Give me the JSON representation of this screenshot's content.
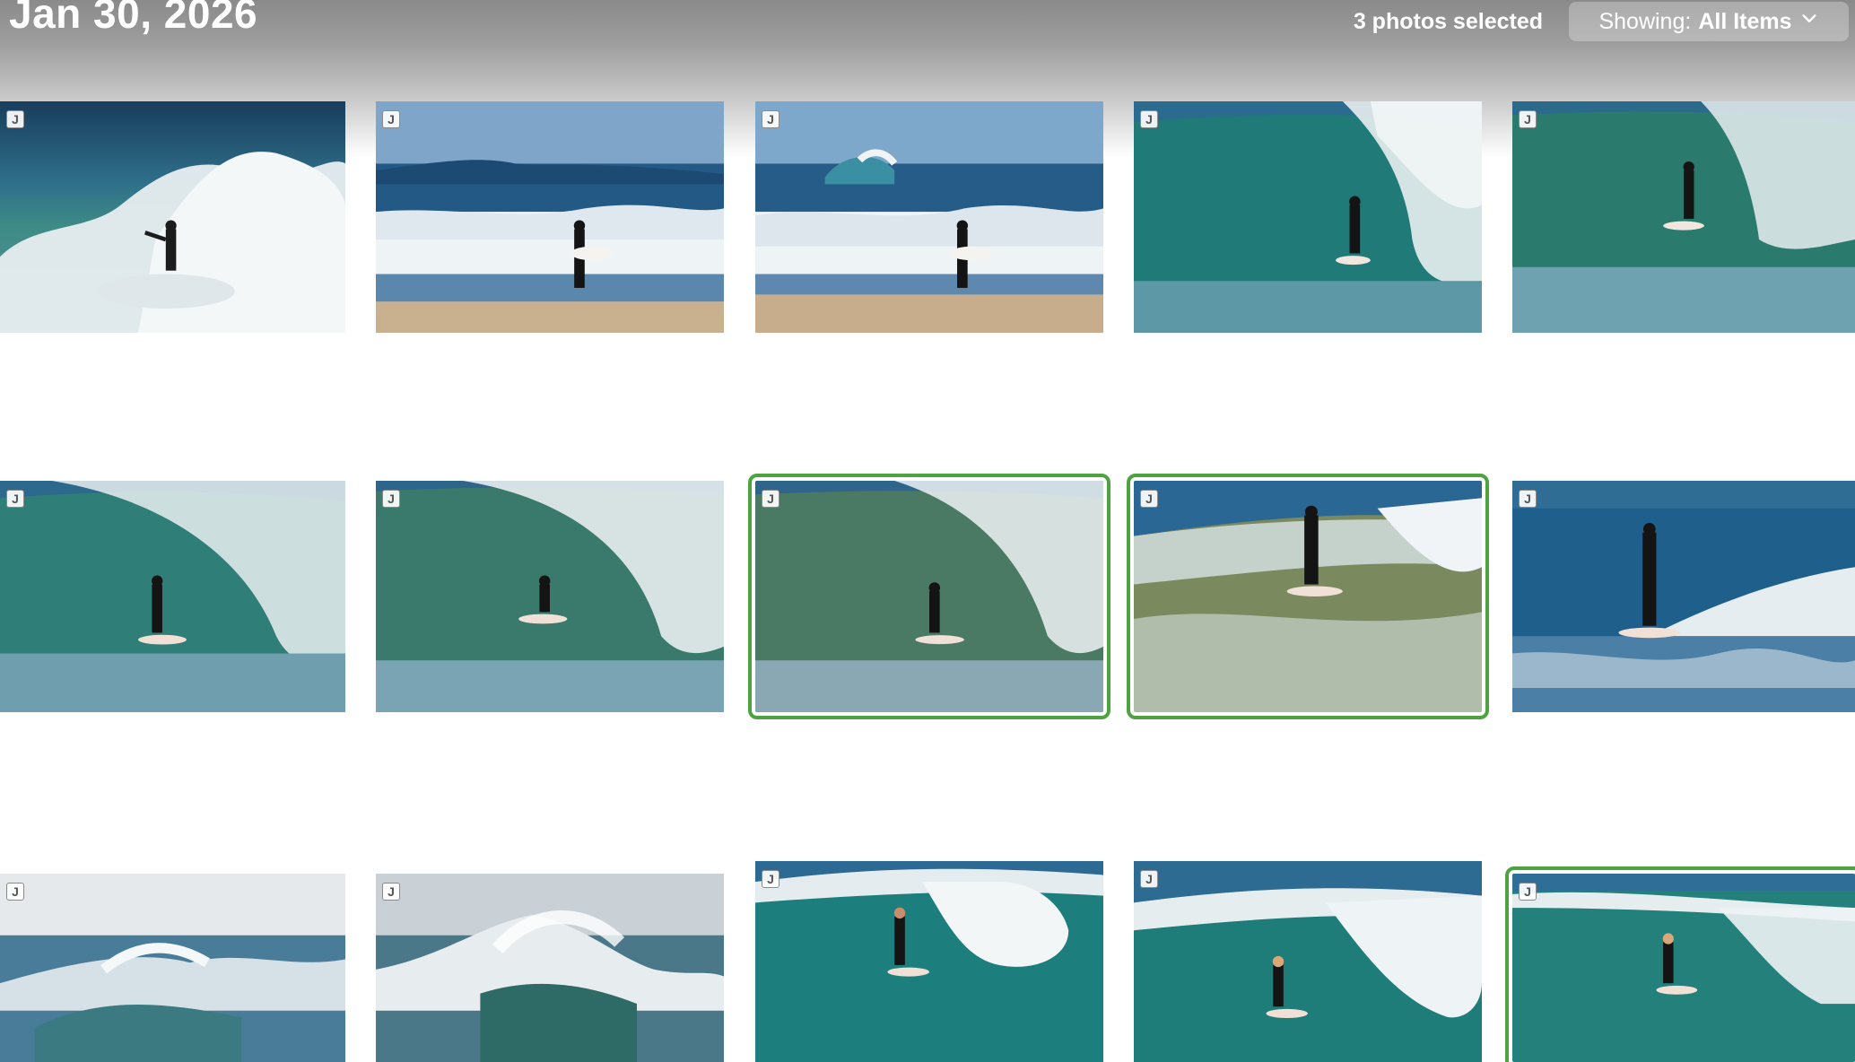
{
  "header": {
    "date": "Jan 30, 2026",
    "selection_status": "3 photos selected",
    "filter": {
      "label": "Showing:",
      "value": "All Items",
      "icon": "chevron-down-icon"
    }
  },
  "colors": {
    "selection_outline": "#4ca33f",
    "header_gradient_top": "#8a8a8a"
  },
  "badge_text": "J",
  "photos": [
    {
      "badge": "J",
      "scene": "surfer-whitewater",
      "selected": false
    },
    {
      "badge": "J",
      "scene": "surfer-walking-beach",
      "selected": false
    },
    {
      "badge": "J",
      "scene": "surfer-walking-beach",
      "selected": false
    },
    {
      "badge": "J",
      "scene": "surfer-barrel-green",
      "selected": false
    },
    {
      "badge": "J",
      "scene": "surfer-barrel-green",
      "selected": false
    },
    {
      "badge": "J",
      "scene": "surfer-barrel-green",
      "selected": false
    },
    {
      "badge": "J",
      "scene": "surfer-barrel-green",
      "selected": false
    },
    {
      "badge": "J",
      "scene": "surfer-barrel-green",
      "selected": true
    },
    {
      "badge": "J",
      "scene": "surfer-riding-foam",
      "selected": true
    },
    {
      "badge": "J",
      "scene": "surfer-riding-blue",
      "selected": false
    },
    {
      "badge": "J",
      "scene": "wave-overcast",
      "selected": false
    },
    {
      "badge": "J",
      "scene": "wave-overcast",
      "selected": false
    },
    {
      "badge": "J",
      "scene": "surfer-barrel-green",
      "selected": false
    },
    {
      "badge": "J",
      "scene": "surfer-barrel-green",
      "selected": false
    },
    {
      "badge": "J",
      "scene": "surfer-barrel-green",
      "selected": true
    }
  ]
}
